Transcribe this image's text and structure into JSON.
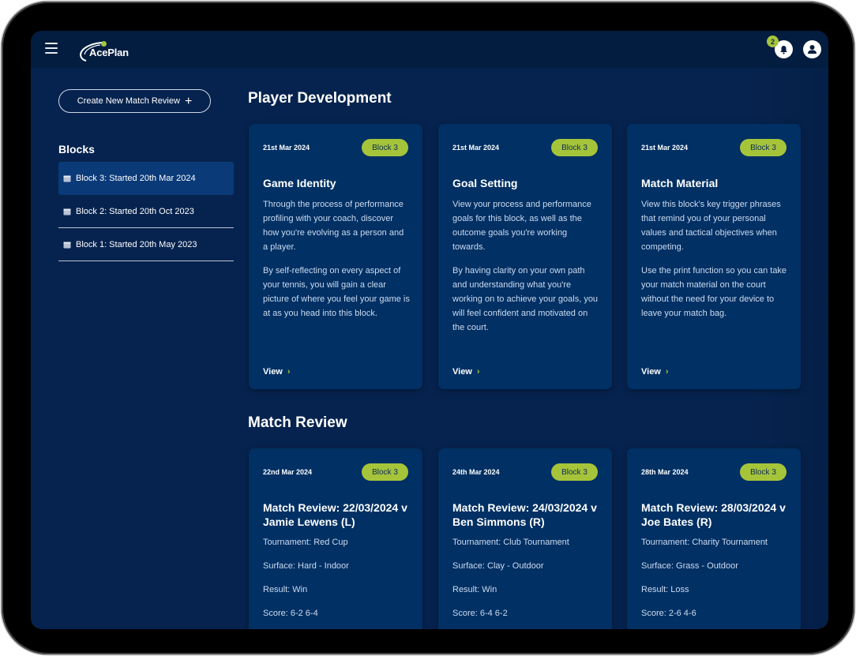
{
  "app": {
    "name": "AcePlan"
  },
  "header": {
    "notification_count": "2"
  },
  "sidebar": {
    "create_button": "Create New Match Review",
    "create_icon": "+",
    "blocks_title": "Blocks",
    "blocks": [
      {
        "label": "Block 3: Started 20th Mar 2024",
        "active": true
      },
      {
        "label": "Block 2: Started 20th Oct 2023",
        "active": false
      },
      {
        "label": "Block 1: Started 20th May 2023",
        "active": false
      }
    ]
  },
  "player_development": {
    "title": "Player Development",
    "cards": [
      {
        "date": "21st Mar 2024",
        "badge": "Block 3",
        "title": "Game Identity",
        "p1": "Through the process of performance profiling with your coach, discover how you're evolving as a person and a player.",
        "p2": "By self-reflecting on every aspect of your tennis, you will gain a clear picture of where you feel your game is at as you head into this block.",
        "view": "View"
      },
      {
        "date": "21st Mar 2024",
        "badge": "Block 3",
        "title": "Goal Setting",
        "p1": "View your process and performance goals for this block, as well as the outcome goals you're working towards.",
        "p2": "By having clarity on your own path and understanding what you're working on to achieve your goals, you will feel confident and motivated on the court.",
        "view": "View"
      },
      {
        "date": "21st Mar 2024",
        "badge": "Block 3",
        "title": "Match Material",
        "p1": "View this block's key trigger phrases that remind you of your personal values and tactical objectives when competing.",
        "p2": "Use the print function so you can take your match material on the court without the need for your device to leave your match bag.",
        "view": "View"
      }
    ]
  },
  "match_review": {
    "title": "Match Review",
    "cards": [
      {
        "date": "22nd Mar 2024",
        "badge": "Block 3",
        "title": "Match Review: 22/03/2024 v Jamie Lewens (L)",
        "tournament": "Tournament: Red Cup",
        "surface": "Surface: Hard - Indoor",
        "result": "Result: Win",
        "score": "Score: 6-2 6-4"
      },
      {
        "date": "24th Mar 2024",
        "badge": "Block 3",
        "title": "Match Review: 24/03/2024 v Ben Simmons (R)",
        "tournament": "Tournament: Club Tournament",
        "surface": "Surface: Clay - Outdoor",
        "result": "Result: Win",
        "score": "Score: 6-4 6-2"
      },
      {
        "date": "28th Mar 2024",
        "badge": "Block 3",
        "title": "Match Review: 28/03/2024 v Joe Bates (R)",
        "tournament": "Tournament: Charity Tournament",
        "surface": "Surface: Grass - Outdoor",
        "result": "Result: Loss",
        "score": "Score: 2-6 4-6"
      }
    ]
  },
  "colors": {
    "accent": "#a6c43a",
    "background": "#06234f",
    "card": "#003064",
    "topbar": "#021d40"
  }
}
